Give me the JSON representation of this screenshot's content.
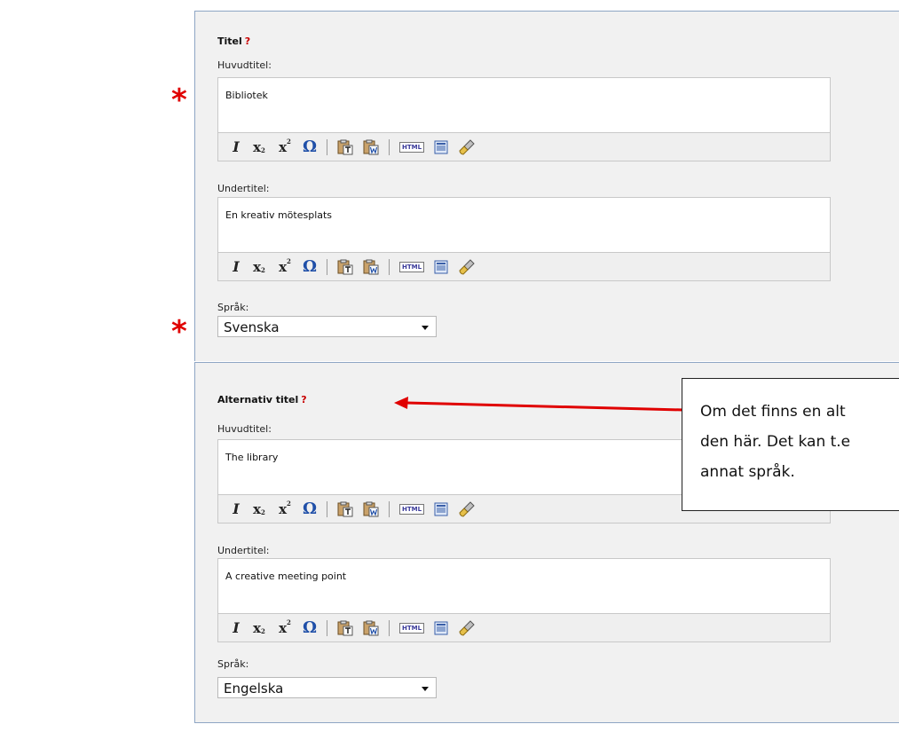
{
  "required_marker": "*",
  "help_marker": "?",
  "colors": {
    "panel_bg": "#f1f1f1",
    "panel_border": "#8ea6c4",
    "required": "#e00000",
    "arrow": "#e00000",
    "help": "#c80000"
  },
  "toolbar_icons": [
    "italic-icon",
    "subscript-icon",
    "superscript-icon",
    "special-char-omega-icon",
    "paste-text-icon",
    "paste-word-icon",
    "html-source-icon",
    "source-view-icon",
    "clean-format-icon"
  ],
  "toolbar": {
    "italic": "I",
    "sub_base": "x",
    "sub_mark": "2",
    "sup_base": "x",
    "sup_mark": "2",
    "omega": "Ω",
    "html": "HTML"
  },
  "title_section": {
    "title": "Titel",
    "main_label": "Huvudtitel:",
    "main_value": "Bibliotek",
    "sub_label": "Undertitel:",
    "sub_value": "En kreativ mötesplats",
    "lang_label": "Språk:",
    "lang_value": "Svenska"
  },
  "alt_section": {
    "title": "Alternativ titel",
    "main_label": "Huvudtitel:",
    "main_value": "The library",
    "sub_label": "Undertitel:",
    "sub_value": "A creative meeting point",
    "lang_label": "Språk:",
    "lang_value": "Engelska"
  },
  "callout": {
    "lines": [
      "Om det finns en alt",
      "den här. Det kan t.e",
      "annat språk."
    ]
  }
}
